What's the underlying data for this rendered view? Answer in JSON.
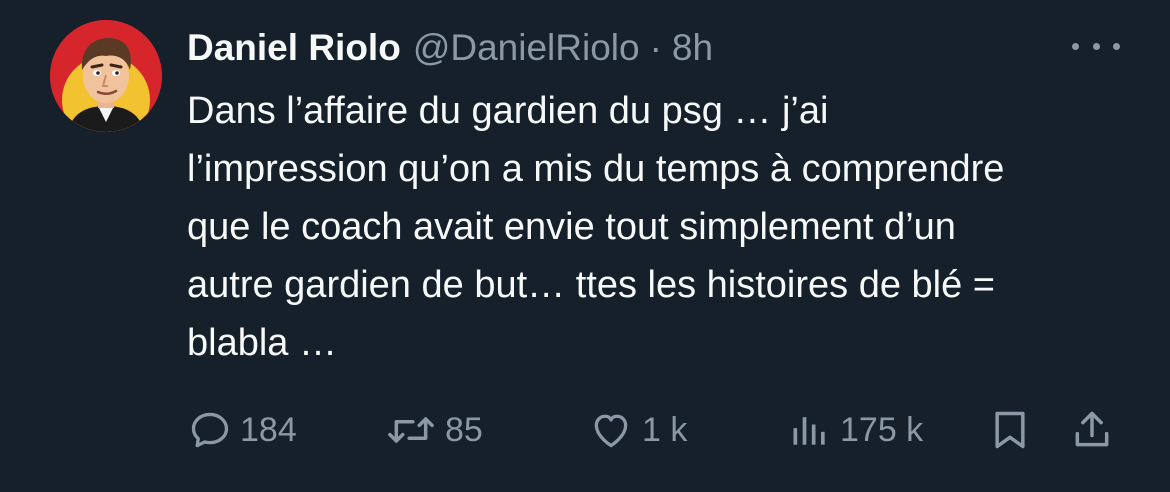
{
  "tweet": {
    "author": {
      "name": "Daniel Riolo",
      "handle": "@DanielRiolo",
      "separator": "·",
      "time": "8h",
      "avatar_icon": "caricature-avatar"
    },
    "more_icon": "more-options-icon",
    "text_lines": [
      "Dans l’affaire du gardien du psg … j’ai",
      "l’impression qu’on a mis du temps à comprendre",
      "que le coach avait envie tout simplement d’un",
      "autre gardien de but… ttes les histoires de blé =",
      "blabla …"
    ],
    "actions": {
      "replies": "184",
      "retweets": "85",
      "likes": "1 k",
      "views": "175 k"
    }
  },
  "colors": {
    "background": "#15202b",
    "text": "#f7f9f9",
    "muted": "#8b98a5"
  }
}
